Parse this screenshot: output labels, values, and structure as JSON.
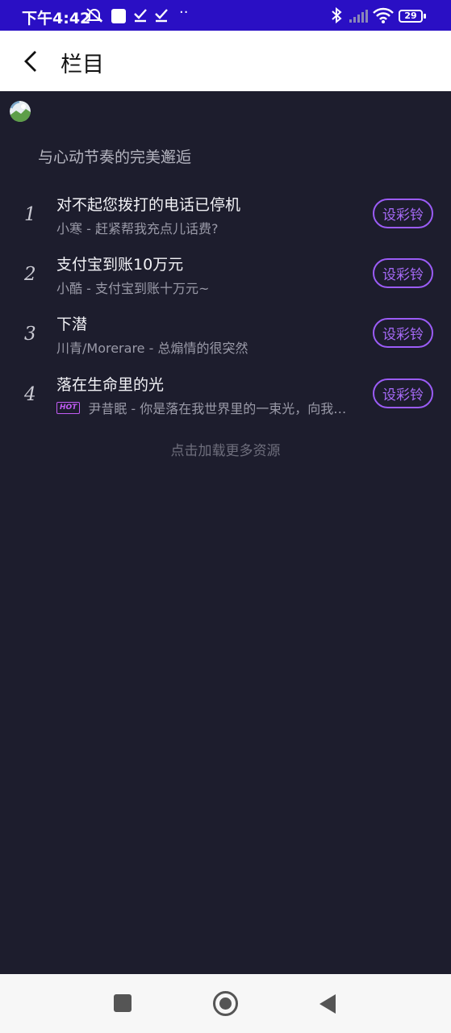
{
  "status_bar": {
    "time": "下午4:42",
    "battery": "29",
    "dots": "··"
  },
  "header": {
    "title": "栏目"
  },
  "section": {
    "title": "与心动节奏的完美邂逅"
  },
  "songs": [
    {
      "rank": "1",
      "title": "对不起您拨打的电话已停机",
      "subtitle": "小寒 - 赶紧帮我充点儿话费?",
      "hot": false,
      "button": "设彩铃"
    },
    {
      "rank": "2",
      "title": "支付宝到账10万元",
      "subtitle": "小酷 - 支付宝到账十万元~",
      "hot": false,
      "button": "设彩铃"
    },
    {
      "rank": "3",
      "title": "下潜",
      "subtitle": "川青/Morerare - 总煽情的很突然",
      "hot": false,
      "button": "设彩铃"
    },
    {
      "rank": "4",
      "title": "落在生命里的光",
      "subtitle": "尹昔眠 - 你是落在我世界里的一束光，向我…",
      "hot": true,
      "hot_label": "HOT",
      "button": "设彩铃"
    }
  ],
  "load_more": "点击加载更多资源",
  "colors": {
    "status_bar": "#2a0fc4",
    "background": "#1d1d2d",
    "accent": "#9b5cf6",
    "hot": "#c25cf5"
  },
  "icons": {
    "back": "chevron-left-icon",
    "nav_recent": "square-icon",
    "nav_home": "circle-icon",
    "nav_back": "triangle-back-icon"
  }
}
